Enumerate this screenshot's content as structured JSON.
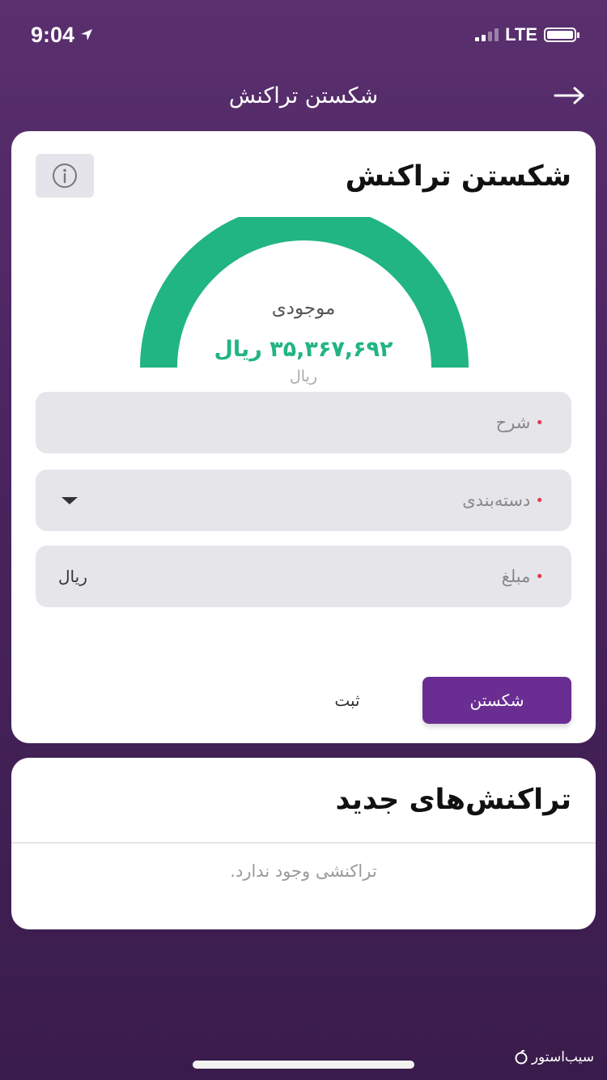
{
  "status_bar": {
    "time": "9:04",
    "network": "LTE"
  },
  "nav": {
    "title": "شکستن تراکنش"
  },
  "split_card": {
    "title": "شکستن تراکنش",
    "gauge": {
      "label": "موجودی",
      "value": "۳۵,۳۶۷,۶۹۲ ریال",
      "unit": "ریال",
      "fill_percent": 100,
      "color": "#21b583"
    },
    "fields": {
      "description": {
        "label": "شرح",
        "required_mark": "•"
      },
      "category": {
        "label": "دسته‌بندی",
        "required_mark": "•"
      },
      "amount": {
        "label": "مبلغ",
        "required_mark": "•",
        "unit": "ریال"
      }
    },
    "primary_button": "شکستن",
    "secondary_button": "ثبت"
  },
  "recent_card": {
    "title": "تراکنش‌های جدید",
    "empty_text": "تراکنشی وجود ندارد."
  },
  "watermark": "سیب‌استور",
  "colors": {
    "brand": "#6a2e93",
    "accent": "#21b583",
    "required": "#e04050"
  }
}
